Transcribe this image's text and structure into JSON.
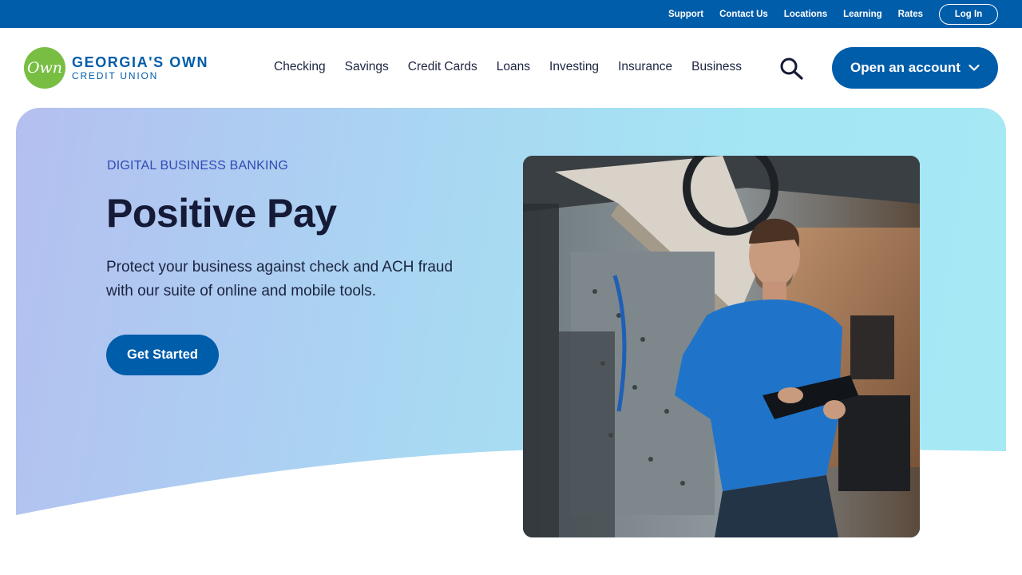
{
  "utility": {
    "links": [
      "Support",
      "Contact Us",
      "Locations",
      "Learning",
      "Rates"
    ],
    "login_label": "Log In"
  },
  "logo": {
    "mark": "Own",
    "line1": "GEORGIA'S OWN",
    "line2": "CREDIT UNION"
  },
  "nav": {
    "items": [
      "Checking",
      "Savings",
      "Credit Cards",
      "Loans",
      "Investing",
      "Insurance",
      "Business"
    ],
    "search_icon": "search-icon",
    "open_account_label": "Open an account"
  },
  "hero": {
    "eyebrow": "DIGITAL BUSINESS BANKING",
    "title": "Positive Pay",
    "description": "Protect your business against check and ACH fraud with our suite of online and mobile tools.",
    "cta_label": "Get Started"
  },
  "colors": {
    "brand_blue": "#005DAA",
    "brand_green": "#78BE43",
    "heading": "#151a36"
  }
}
